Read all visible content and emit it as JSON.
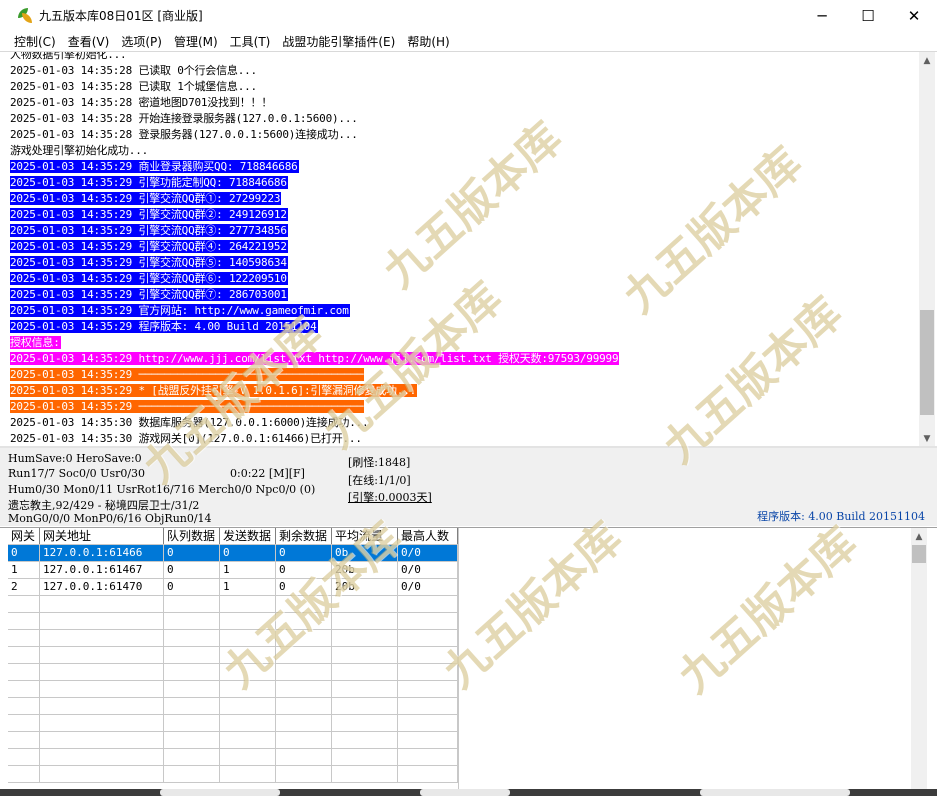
{
  "window": {
    "title": "九五版本库08日01区 [商业版]",
    "controls": {
      "minimize": "─",
      "maximize": "☐",
      "close": "✕"
    }
  },
  "menu": [
    "控制(C)",
    "查看(V)",
    "选项(P)",
    "管理(M)",
    "工具(T)",
    "战盟功能引擎插件(E)",
    "帮助(H)"
  ],
  "log": {
    "lines": [
      {
        "text": "人物数据引擎初始化...",
        "bg": "",
        "fg": "#000000"
      },
      {
        "text": "2025-01-03 14:35:28 已读取 0个行会信息...",
        "bg": "",
        "fg": "#000000"
      },
      {
        "text": "2025-01-03 14:35:28 已读取 1个城堡信息...",
        "bg": "",
        "fg": "#000000"
      },
      {
        "text": "2025-01-03 14:35:28 密道地图D701没找到！！！",
        "bg": "",
        "fg": "#000000"
      },
      {
        "text": "2025-01-03 14:35:28 开始连接登录服务器(127.0.0.1:5600)...",
        "bg": "",
        "fg": "#000000"
      },
      {
        "text": "2025-01-03 14:35:28 登录服务器(127.0.0.1:5600)连接成功...",
        "bg": "",
        "fg": "#000000"
      },
      {
        "text": "游戏处理引擎初始化成功...",
        "bg": "",
        "fg": "#000000"
      },
      {
        "text": "2025-01-03 14:35:29 商业登录器购买QQ: 718846686",
        "bg": "#0000ff",
        "fg": "#ffffff"
      },
      {
        "text": "2025-01-03 14:35:29 引擎功能定制QQ: 718846686",
        "bg": "#0000ff",
        "fg": "#ffffff"
      },
      {
        "text": "2025-01-03 14:35:29 引擎交流QQ群①: 27299223",
        "bg": "#0000ff",
        "fg": "#ffffff"
      },
      {
        "text": "2025-01-03 14:35:29 引擎交流QQ群②: 249126912",
        "bg": "#0000ff",
        "fg": "#ffffff"
      },
      {
        "text": "2025-01-03 14:35:29 引擎交流QQ群③: 277734856",
        "bg": "#0000ff",
        "fg": "#ffffff"
      },
      {
        "text": "2025-01-03 14:35:29 引擎交流QQ群④: 264221952",
        "bg": "#0000ff",
        "fg": "#ffffff"
      },
      {
        "text": "2025-01-03 14:35:29 引擎交流QQ群⑤: 140598634",
        "bg": "#0000ff",
        "fg": "#ffffff"
      },
      {
        "text": "2025-01-03 14:35:29 引擎交流QQ群⑥: 122209510",
        "bg": "#0000ff",
        "fg": "#ffffff"
      },
      {
        "text": "2025-01-03 14:35:29 引擎交流QQ群⑦: 286703001",
        "bg": "#0000ff",
        "fg": "#ffffff"
      },
      {
        "text": "2025-01-03 14:35:29 官方网站: http://www.gameofmir.com",
        "bg": "#0000ff",
        "fg": "#ffffff"
      },
      {
        "text": "2025-01-03 14:35:29 程序版本: 4.00 Build 20151104",
        "bg": "#0000ff",
        "fg": "#ffffff"
      },
      {
        "text": "授权信息:",
        "bg": "#ff00ff",
        "fg": "#ffffff"
      },
      {
        "text": "2025-01-03 14:35:29 http://www.jjj.com/list.txt http://www.jjj.com/list.txt 授权天数:97593/99999",
        "bg": "#ff00ff",
        "fg": "#ffffff"
      },
      {
        "text": "2025-01-03 14:35:29 ───────────────────────────────────",
        "bg": "#ff6600",
        "fg": "#ffffff"
      },
      {
        "text": "2025-01-03 14:35:29 * [战盟反外挂引擎-V 1.0.1.6]:引擎漏洞修复成功...",
        "bg": "#ff6600",
        "fg": "#ffffff"
      },
      {
        "text": "2025-01-03 14:35:29 ───────────────────────────────────",
        "bg": "#ff6600",
        "fg": "#ffffff"
      },
      {
        "text": "2025-01-03 14:35:30 数据库服务器(127.0.0.1:6000)连接成功...",
        "bg": "",
        "fg": "#000000"
      },
      {
        "text": "2025-01-03 14:35:30 游戏网关[0](127.0.0.1:61466)已打开...",
        "bg": "",
        "fg": "#000000"
      }
    ]
  },
  "status": {
    "line1": "HumSave:0 HeroSave:0",
    "line2": "Run17/7 Soc0/0 Usr0/30",
    "timer": "0:0:22 [M][F]",
    "line3": "Hum0/30 Mon0/11 UsrRot16/716 Merch0/0 Npc0/0 (0)",
    "line4": "遗忘教主,92/429 - 秘境四层卫士/31/2",
    "line5": "MonG0/0/0 MonP0/6/16 ObjRun0/14",
    "refresh": "[刷怪:1848]",
    "online": "[在线:1/1/0]",
    "engine": "[引擎:0.0003天]",
    "version": "程序版本: 4.00 Build 20151104"
  },
  "grid": {
    "headers": [
      "网关",
      "网关地址",
      "队列数据",
      "发送数据",
      "剩余数据",
      "平均流量",
      "最高人数"
    ],
    "rows": [
      [
        "0",
        "127.0.0.1:61466",
        "0",
        "0",
        "0",
        "0b",
        "0/0"
      ],
      [
        "1",
        "127.0.0.1:61467",
        "0",
        "1",
        "0",
        "20b",
        "0/0"
      ],
      [
        "2",
        "127.0.0.1:61470",
        "0",
        "1",
        "0",
        "20b",
        "0/0"
      ]
    ],
    "selected_row": 0
  },
  "watermark": "九五版本库",
  "icons": {
    "app": "app-leaf-icon",
    "scroll_up": "scroll-up-icon",
    "scroll_down": "scroll-down-icon"
  }
}
